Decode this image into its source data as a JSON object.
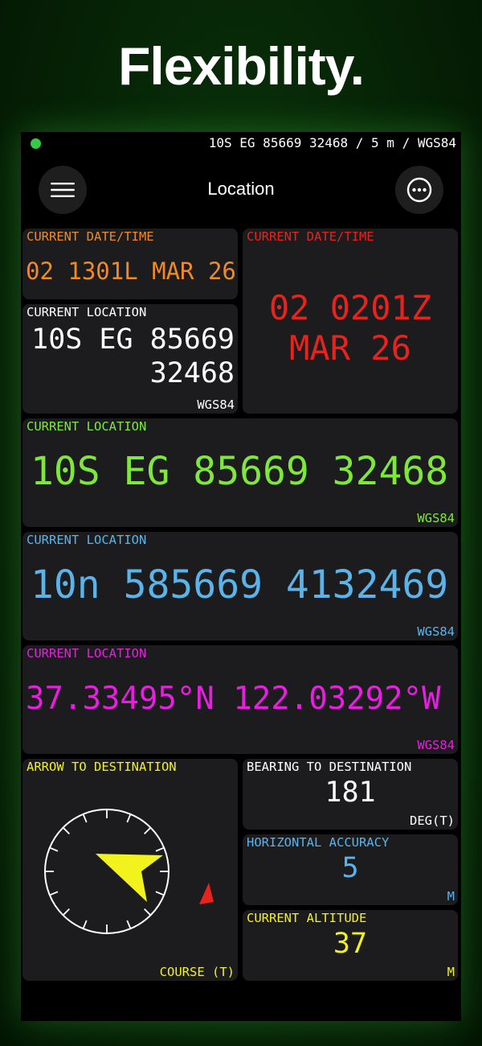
{
  "headline": "Flexibility.",
  "status_bar": {
    "text": "10S EG 85669 32468 / 5 m / WGS84",
    "gps_color": "#35c84a"
  },
  "nav": {
    "title": "Location",
    "menu_icon": "hamburger-menu-icon",
    "more_icon": "ellipsis-circle-icon"
  },
  "tiles": {
    "local_time": {
      "label": "CURRENT DATE/TIME",
      "value": "02 1301L MAR 26",
      "color": "#f08a24"
    },
    "zulu_time": {
      "label": "CURRENT DATE/TIME",
      "line1": "02 0201Z",
      "line2": "MAR 26",
      "color": "#e8221c"
    },
    "mgrs_small": {
      "label": "CURRENT LOCATION",
      "line1": "10S EG 85669",
      "line2": "32468",
      "datum": "WGS84",
      "color": "#ffffff"
    },
    "mgrs_large": {
      "label": "CURRENT LOCATION",
      "value": "10S EG 85669 32468",
      "datum": "WGS84",
      "color": "#7ee83a"
    },
    "utm": {
      "label": "CURRENT LOCATION",
      "value": "10n 585669 4132469",
      "datum": "WGS84",
      "color": "#5ab4ea"
    },
    "latlon": {
      "label": "CURRENT LOCATION",
      "value": "37.33495°N 122.03292°W",
      "datum": "WGS84",
      "color": "#e81ee0"
    },
    "arrow": {
      "label": "ARROW TO DESTINATION",
      "footer": "COURSE (T)",
      "color": "#f2f21c",
      "course_marker_color": "#e8221c"
    },
    "bearing": {
      "label": "BEARING TO DESTINATION",
      "value": "181",
      "unit": "DEG(T)",
      "color": "#ffffff"
    },
    "accuracy": {
      "label": "HORIZONTAL ACCURACY",
      "value": "5",
      "unit": "M",
      "color": "#5ab4ea"
    },
    "altitude": {
      "label": "CURRENT ALTITUDE",
      "value": "37",
      "unit": "M",
      "color": "#f2f21c"
    }
  }
}
